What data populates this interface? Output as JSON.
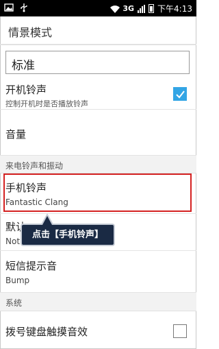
{
  "status_bar": {
    "network": "3G",
    "time": "下午4:13",
    "icons": [
      "image-icon",
      "usb-icon",
      "wifi-icon",
      "signal-icon",
      "battery-icon"
    ]
  },
  "titlebar": {
    "title": "情景模式"
  },
  "profile_name": {
    "value": "标准"
  },
  "boot_ringtone": {
    "label": "开机铃声",
    "sub": "控制开机时是否播放铃声",
    "checked": true
  },
  "volume": {
    "label": "音量"
  },
  "section_ringtone": {
    "label": "来电铃声和振动"
  },
  "phone_ringtone": {
    "label": "手机铃声",
    "sub": "Fantastic Clang"
  },
  "default_notification": {
    "label": "默认",
    "sub": "Not"
  },
  "sms_tone": {
    "label": "短信提示音",
    "sub": "Bump"
  },
  "section_system": {
    "label": "系统"
  },
  "dial_pad_tones": {
    "label": "拨号键盘触摸音效",
    "checked": false
  },
  "callout": {
    "text": "点击【手机铃声】"
  },
  "colors": {
    "accent": "#33a5e5",
    "highlight": "#d42020",
    "callout_bg": "#1a2a44"
  }
}
